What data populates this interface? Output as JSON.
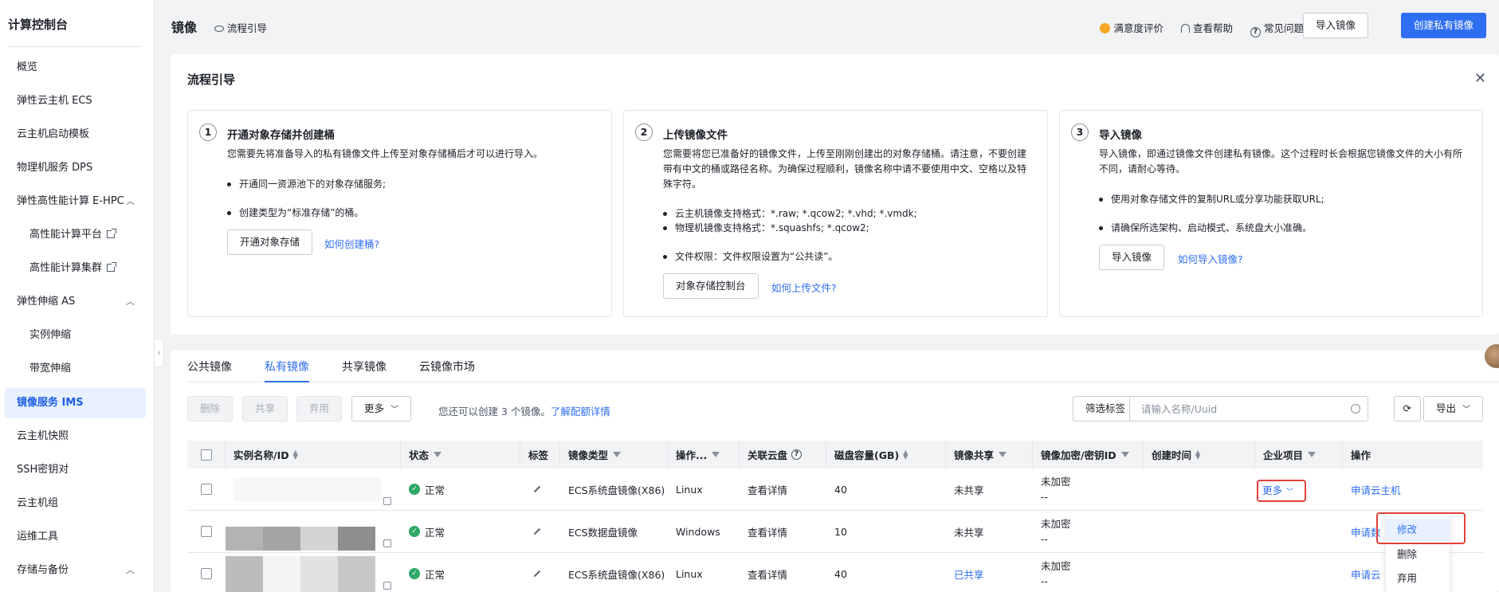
{
  "sidebar": {
    "title": "计算控制台",
    "items": [
      {
        "label": "概览"
      },
      {
        "label": "弹性云主机 ECS"
      },
      {
        "label": "云主机启动模板"
      },
      {
        "label": "物理机服务 DPS"
      },
      {
        "label": "弹性高性能计算 E-HPC"
      },
      {
        "label": "高性能计算平台"
      },
      {
        "label": "高性能计算集群"
      },
      {
        "label": "弹性伸缩 AS"
      },
      {
        "label": "实例伸缩"
      },
      {
        "label": "带宽伸缩"
      },
      {
        "label": "镜像服务 IMS"
      },
      {
        "label": "云主机快照"
      },
      {
        "label": "SSH密钥对"
      },
      {
        "label": "云主机组"
      },
      {
        "label": "运维工具"
      },
      {
        "label": "存储与备份"
      }
    ]
  },
  "header": {
    "title": "镜像",
    "guide_label": "流程引导",
    "satisfaction": "满意度评价",
    "help": "查看帮助",
    "faq": "常见问题",
    "import_button": "导入镜像",
    "create_button": "创建私有镜像"
  },
  "guide": {
    "title": "流程引导",
    "steps": [
      {
        "num": "1",
        "title": "开通对象存储并创建桶",
        "desc": "您需要先将准备导入的私有镜像文件上传至对象存储桶后才可以进行导入。",
        "bullets": [
          "开通同一资源池下的对象存储服务;",
          "创建类型为“标准存储”的桶。"
        ],
        "button": "开通对象存储",
        "link": "如何创建桶?"
      },
      {
        "num": "2",
        "title": "上传镜像文件",
        "desc": "您需要将您已准备好的镜像文件，上传至刚刚创建出的对象存储桶。请注意，不要创建带有中文的桶或路径名称。为确保过程顺利，镜像名称中请不要使用中文、空格以及特殊字符。",
        "bullets": [
          "云主机镜像支持格式：*.raw; *.qcow2; *.vhd; *.vmdk;",
          "物理机镜像支持格式：*.squashfs; *.qcow2;",
          "文件权限：文件权限设置为“公共读”。"
        ],
        "button": "对象存储控制台",
        "link": "如何上传文件?"
      },
      {
        "num": "3",
        "title": "导入镜像",
        "desc": "导入镜像，即通过镜像文件创建私有镜像。这个过程时长会根据您镜像文件的大小有所不同，请耐心等待。",
        "bullets": [
          "使用对象存储文件的复制URL或分享功能获取URL;",
          "请确保所选架构、启动模式、系统盘大小准确。"
        ],
        "button": "导入镜像",
        "link": "如何导入镜像?"
      }
    ]
  },
  "tabs": [
    "公共镜像",
    "私有镜像",
    "共享镜像",
    "云镜像市场"
  ],
  "toolbar": {
    "delete": "删除",
    "share": "共享",
    "deprecate": "弃用",
    "more": "更多",
    "tip": "您还可以创建 3 个镜像。",
    "tip_link": "了解配额详情",
    "filter_tags": "筛选标签",
    "search_placeholder": "请输入名称/Uuid",
    "export": "导出"
  },
  "table": {
    "headers": {
      "name": "实例名称/ID",
      "status": "状态",
      "tag": "标签",
      "type": "镜像类型",
      "os": "操作...",
      "disk": "关联云盘",
      "size": "磁盘容量(GB)",
      "share": "镜像共享",
      "encrypt": "镜像加密/密钥ID",
      "created": "创建时间",
      "project": "企业项目",
      "action": "操作"
    },
    "rows": [
      {
        "status": "正常",
        "type": "ECS系统盘镜像(X86)",
        "os": "Linux",
        "disk": "查看详情",
        "size": "40",
        "share": "未共享",
        "encrypt": "未加密",
        "encrypt_sub": "--",
        "action": "申请云主机",
        "more": "更多"
      },
      {
        "status": "正常",
        "type": "ECS数据盘镜像",
        "os": "Windows",
        "disk": "查看详情",
        "size": "10",
        "share": "未共享",
        "encrypt": "未加密",
        "encrypt_sub": "--",
        "action": "申请数"
      },
      {
        "status": "正常",
        "type": "ECS系统盘镜像(X86)",
        "os": "Linux",
        "disk": "查看详情",
        "size": "40",
        "share": "已共享",
        "encrypt": "未加密",
        "encrypt_sub": "--",
        "action": "申请云"
      }
    ]
  },
  "dropdown": [
    "修改",
    "删除",
    "弃用"
  ],
  "colors": {
    "primary": "#2e6ef2",
    "success": "#2ea968",
    "highlight": "#e0423a",
    "active_bg": "#e8f1ff"
  }
}
